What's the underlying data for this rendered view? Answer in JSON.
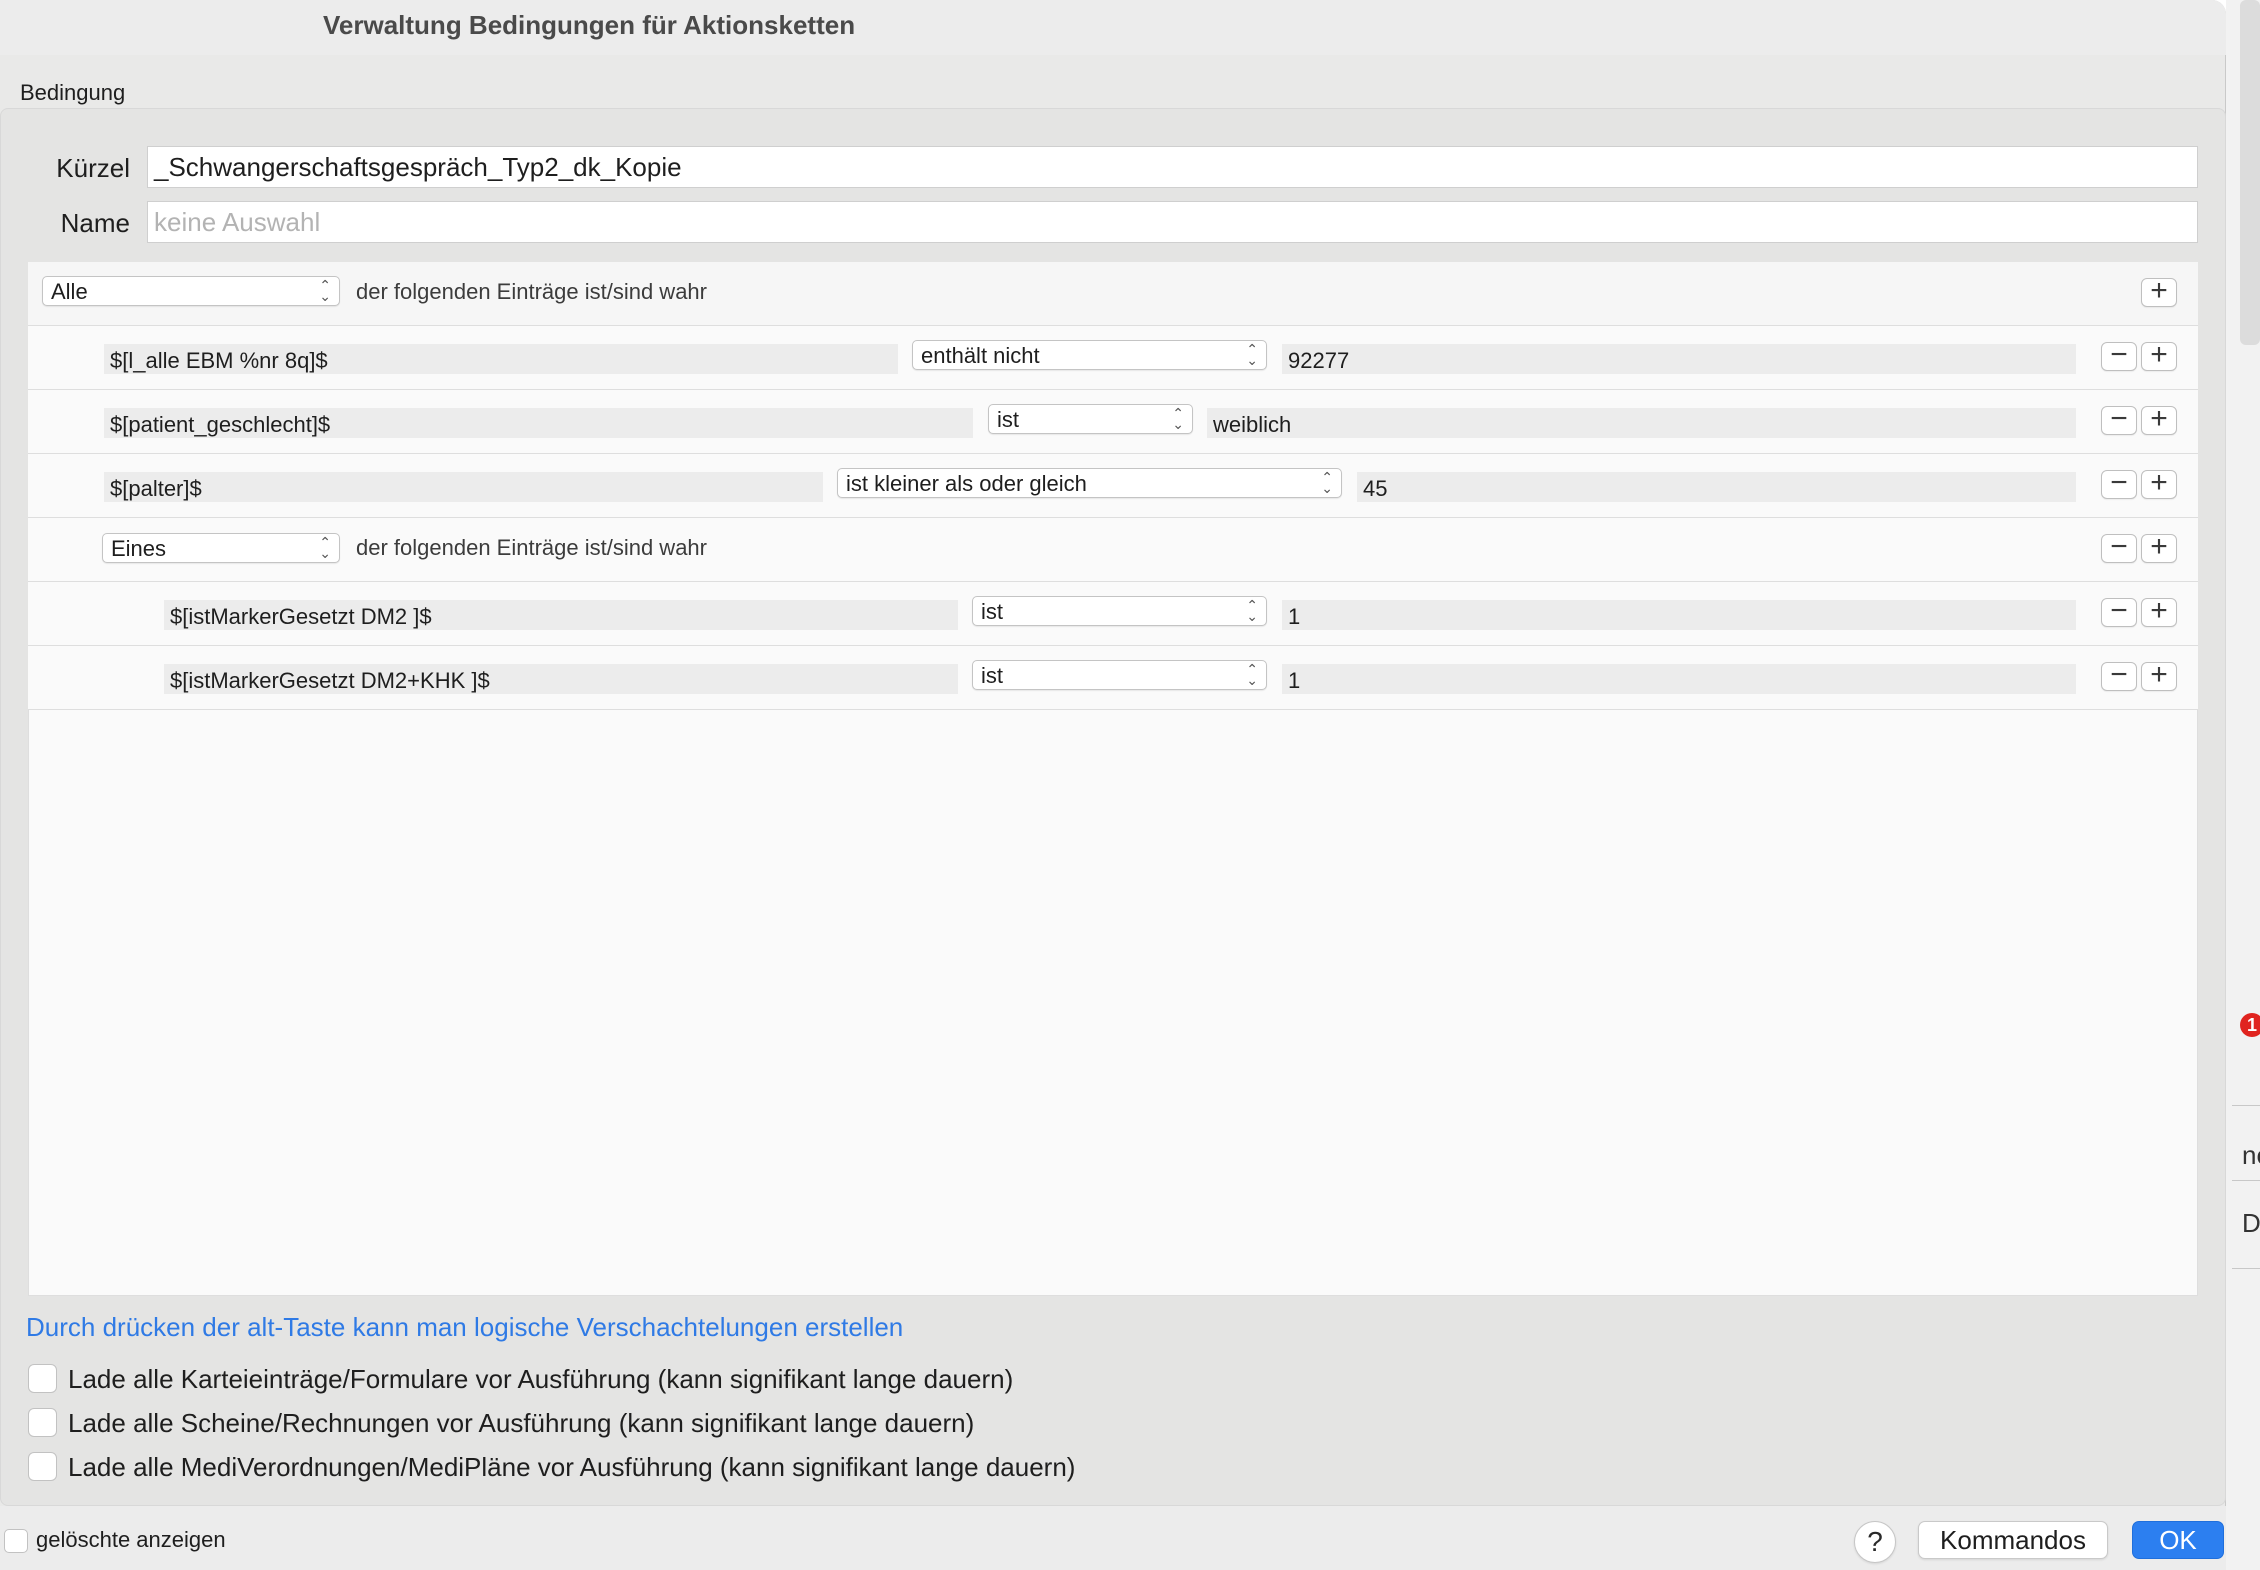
{
  "window": {
    "title": "Verwaltung Bedingungen für Aktionsketten",
    "group_label": "Bedingung"
  },
  "form": {
    "kuerzel_label": "Kürzel",
    "kuerzel_value": "_Schwangerschaftsgespräch_Typ2_dk_Kopie",
    "name_label": "Name",
    "name_placeholder": "keine Auswahl"
  },
  "rules": {
    "root": {
      "quantifier": "Alle",
      "text": "der folgenden Einträge ist/sind wahr"
    },
    "conditions": [
      {
        "variable": "$[l_alle EBM %nr 8q]$",
        "operator": "enthält nicht",
        "value": "92277"
      },
      {
        "variable": "$[patient_geschlecht]$",
        "operator": "ist",
        "value": "weiblich"
      },
      {
        "variable": "$[palter]$",
        "operator": "ist kleiner als oder gleich",
        "value": "45"
      }
    ],
    "subgroup": {
      "quantifier": "Eines",
      "text": "der folgenden Einträge ist/sind wahr",
      "conditions": [
        {
          "variable": "$[istMarkerGesetzt DM2 ]$",
          "operator": "ist",
          "value": "1"
        },
        {
          "variable": "$[istMarkerGesetzt DM2+KHK ]$",
          "operator": "ist",
          "value": "1"
        }
      ]
    },
    "minus_symbol": "−",
    "plus_symbol": "+"
  },
  "hint": "Durch drücken der alt-Taste kann man logische Verschachtelungen erstellen",
  "options": [
    {
      "label": "Lade alle Karteieinträge/Formulare vor Ausführung (kann signifikant lange dauern)",
      "checked": false
    },
    {
      "label": "Lade alle Scheine/Rechnungen vor Ausführung (kann signifikant lange dauern)",
      "checked": false
    },
    {
      "label": "Lade alle MediVerordnungen/MediPläne vor Ausführung (kann signifikant lange dauern)",
      "checked": false
    }
  ],
  "footer": {
    "show_deleted_label": "gelöschte anzeigen",
    "help_label": "?",
    "kommandos_label": "Kommandos",
    "ok_label": "OK"
  },
  "background": {
    "badge": "1",
    "text1": "ne",
    "text2": "Do"
  },
  "colors": {
    "accent": "#2c7ff0",
    "hint": "#2f7ae5",
    "window_bg": "#e9e9e8",
    "rule_bg": "#fafafa"
  }
}
